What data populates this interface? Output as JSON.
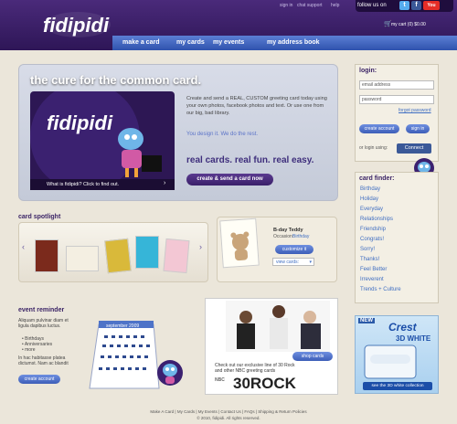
{
  "header": {
    "logo_text": "fidipidi",
    "signin": "sign in",
    "chat": "chat support",
    "help": "help",
    "follow": "follow us on",
    "cart": "my cart (0) $0.00"
  },
  "nav": [
    "make a card",
    "my cards",
    "my events",
    "my address book"
  ],
  "hero": {
    "title": "the cure for the common card.",
    "body": "Create and send a REAL, CUSTOM greeting card today using your own photos, facebook photos and text. Or use one from our big, bad library.",
    "tag2": "You design it. We do the rest.",
    "tag3": "real cards. real fun. real easy.",
    "caption": "What is fidipidi? Click to find out.",
    "cta": "create & send a card now",
    "logo_text": "fidipidi"
  },
  "login": {
    "title": "login:",
    "email_placeholder": "email address",
    "password_placeholder": "password",
    "forgot": "forgot password",
    "create": "create account",
    "signin": "sign in",
    "or": "or login using:",
    "connect": "Connect"
  },
  "finder": {
    "title": "card finder:",
    "items": [
      "Birthday",
      "Holiday",
      "Everyday",
      "Relationships",
      "Friendship",
      "Congrats!",
      "Sorry!",
      "Thanks!",
      "Feel Better",
      "Irreverent",
      "Trends + Culture"
    ]
  },
  "spotlight": {
    "title": "card spotlight",
    "card_name": "B-day Teddy",
    "occasion_label": "Occasion:",
    "occasion": "Birthday",
    "customize": "customize it",
    "view": "view cards:"
  },
  "event": {
    "title": "event reminder",
    "intro": "Aliquam pulvinar diam et ligula dapibus luctus.",
    "bullets": [
      "Birthdays",
      "Anniversaries",
      "more"
    ],
    "outro": "In hac habitasse platea dictumst. Nam ac blandit",
    "cta": "create account",
    "cal_month": "september 2009"
  },
  "ad": {
    "shop": "shop cards",
    "text": "Check out our exclusive line of 30 Rock and other NBC greeting cards",
    "brand": "30ROCK",
    "network": "NBC"
  },
  "crest": {
    "new": "NEW",
    "brand": "Crest",
    "product": "3D WHITE",
    "cta": "see the 3D white collection"
  },
  "footer": {
    "links": "Make A Card  |  My Cards  |  My Events  |  Contact Us  |  FAQs  |  Shipping & Return Policies",
    "copyright": "© 2010, fidipidi. All rights reserved."
  }
}
